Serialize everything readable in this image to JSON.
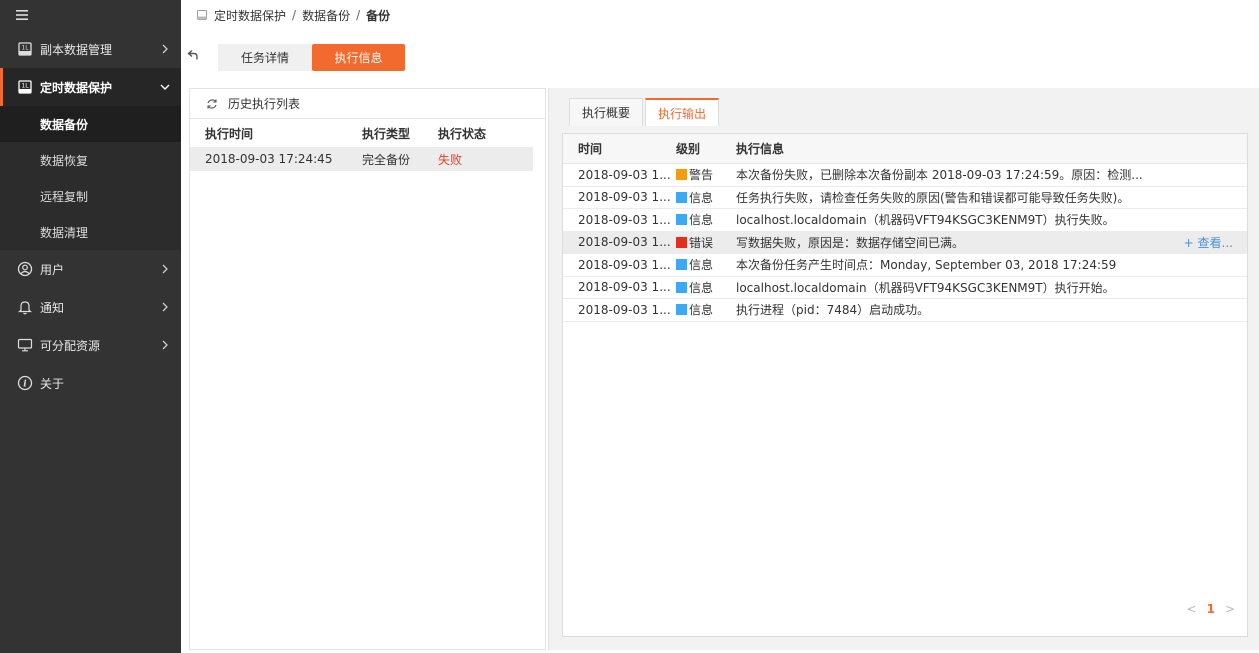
{
  "sidebar": {
    "menu_items": [
      {
        "label": "副本数据管理",
        "icon": "copy-data-icon"
      },
      {
        "label": "定时数据保护",
        "icon": "scheduled-protect-icon"
      }
    ],
    "sub_items": [
      {
        "label": "数据备份"
      },
      {
        "label": "数据恢复"
      },
      {
        "label": "远程复制"
      },
      {
        "label": "数据清理"
      }
    ],
    "bottom_items": [
      {
        "label": "用户",
        "icon": "user-icon"
      },
      {
        "label": "通知",
        "icon": "bell-icon"
      },
      {
        "label": "可分配资源",
        "icon": "monitor-icon"
      },
      {
        "label": "关于",
        "icon": "info-icon"
      }
    ]
  },
  "breadcrumb": {
    "items": [
      "定时数据保护",
      "数据备份",
      "备份"
    ],
    "separator": "/"
  },
  "top_tabs": {
    "detail": "任务详情",
    "exec_info": "执行信息"
  },
  "history": {
    "title": "历史执行列表",
    "columns": [
      "执行时间",
      "执行类型",
      "执行状态"
    ],
    "rows": [
      {
        "time": "2018-09-03 17:24:45",
        "type": "完全备份",
        "status": "失败"
      }
    ]
  },
  "exec_tabs": {
    "summary": "执行概要",
    "output": "执行输出"
  },
  "log": {
    "columns": [
      "时间",
      "级别",
      "执行信息"
    ],
    "rows": [
      {
        "time": "2018-09-03 1...",
        "level": "警告",
        "level_color": "#f39c12",
        "message": "本次备份失败，已删除本次备份副本 2018-09-03 17:24:59。原因：检测..."
      },
      {
        "time": "2018-09-03 1...",
        "level": "信息",
        "level_color": "#3ea8f4",
        "message": "任务执行失败，请检查任务失败的原因(警告和错误都可能导致任务失败)。"
      },
      {
        "time": "2018-09-03 1...",
        "level": "信息",
        "level_color": "#3ea8f4",
        "message": "localhost.localdomain（机器码VFT94KSGC3KENM9T）执行失败。"
      },
      {
        "time": "2018-09-03 1...",
        "level": "错误",
        "level_color": "#e0301e",
        "message": "写数据失败，原因是：数据存储空间已满。",
        "more": "+ 查看..."
      },
      {
        "time": "2018-09-03 1...",
        "level": "信息",
        "level_color": "#3ea8f4",
        "message": "本次备份任务产生时间点：Monday, September 03, 2018 17:24:59"
      },
      {
        "time": "2018-09-03 1...",
        "level": "信息",
        "level_color": "#3ea8f4",
        "message": "localhost.localdomain（机器码VFT94KSGC3KENM9T）执行开始。"
      },
      {
        "time": "2018-09-03 1...",
        "level": "信息",
        "level_color": "#3ea8f4",
        "message": "执行进程（pid：7484）启动成功。"
      }
    ]
  },
  "pager": {
    "prev": "<",
    "page": "1",
    "next": ">"
  },
  "colors": {
    "accent": "#f26a2e",
    "sidebar_bg": "#333333",
    "fail": "#e8412c"
  }
}
